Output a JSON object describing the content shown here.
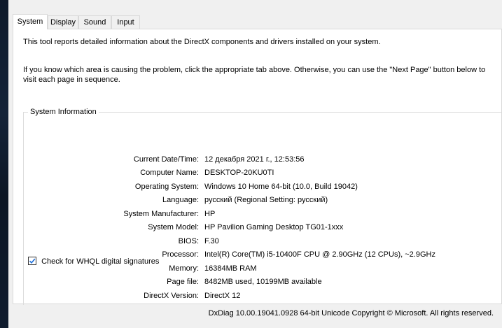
{
  "tabs": [
    {
      "label": "System",
      "active": true
    },
    {
      "label": "Display",
      "active": false
    },
    {
      "label": "Sound",
      "active": false
    },
    {
      "label": "Input",
      "active": false
    }
  ],
  "intro": {
    "line1": "This tool reports detailed information about the DirectX components and drivers installed on your system.",
    "line2": "If you know which area is causing the problem, click the appropriate tab above.  Otherwise, you can use the \"Next Page\" button below to visit each page in sequence."
  },
  "system_info": {
    "title": "System Information",
    "rows": [
      {
        "label": "Current Date/Time:",
        "value": "12 декабря 2021 г., 12:53:56"
      },
      {
        "label": "Computer Name:",
        "value": "DESKTOP-20KU0TI"
      },
      {
        "label": "Operating System:",
        "value": "Windows 10 Home 64-bit (10.0, Build 19042)"
      },
      {
        "label": "Language:",
        "value": "русский (Regional Setting: русский)"
      },
      {
        "label": "System Manufacturer:",
        "value": "HP"
      },
      {
        "label": "System Model:",
        "value": "HP Pavilion Gaming Desktop TG01-1xxx"
      },
      {
        "label": "BIOS:",
        "value": "F.30"
      },
      {
        "label": "Processor:",
        "value": "Intel(R) Core(TM) i5-10400F CPU @ 2.90GHz (12 CPUs), ~2.9GHz"
      },
      {
        "label": "Memory:",
        "value": "16384MB RAM"
      },
      {
        "label": "Page file:",
        "value": "8482MB used, 10199MB available"
      },
      {
        "label": "DirectX Version:",
        "value": "DirectX 12"
      }
    ]
  },
  "whql_checkbox": {
    "label": "Check for WHQL digital signatures",
    "checked": true
  },
  "footer": {
    "text": "DxDiag 10.00.19041.0928 64-bit Unicode  Copyright © Microsoft. All rights reserved."
  },
  "colors": {
    "checkbox_accent": "#1e6fd9",
    "panel_background": "#ffffff",
    "window_background": "#f0f0f0"
  }
}
